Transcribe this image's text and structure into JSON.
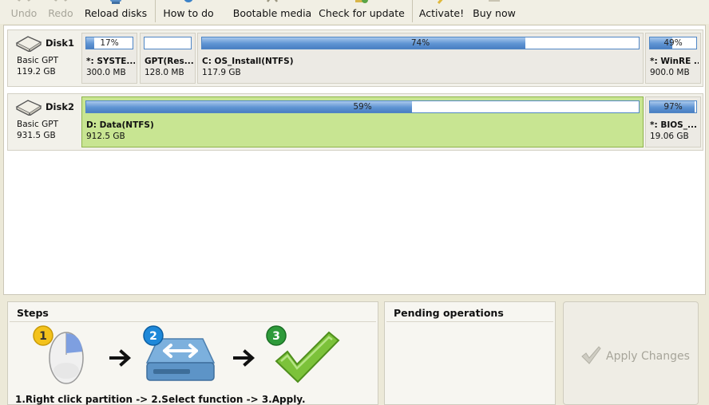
{
  "toolbar": {
    "undo": "Undo",
    "redo": "Redo",
    "reload": "Reload disks",
    "howto": "How to do",
    "bootable": "Bootable media",
    "update": "Check for update",
    "activate": "Activate!",
    "buy": "Buy now"
  },
  "disks": [
    {
      "name": "Disk1",
      "type": "Basic GPT",
      "size": "119.2 GB",
      "partitions": [
        {
          "label": "*: SYSTE...",
          "size": "300.0 MB",
          "used_pct": 17,
          "pct_text": "17%"
        },
        {
          "label": "GPT(Res...",
          "size": "128.0 MB",
          "used_pct": 0,
          "pct_text": ""
        },
        {
          "label": "C: OS_Install(NTFS)",
          "size": "117.9 GB",
          "used_pct": 74,
          "pct_text": "74%"
        },
        {
          "label": "*: WinRE ...",
          "size": "900.0 MB",
          "used_pct": 49,
          "pct_text": "49%"
        }
      ]
    },
    {
      "name": "Disk2",
      "type": "Basic GPT",
      "size": "931.5 GB",
      "partitions": [
        {
          "label": "D: Data(NTFS)",
          "size": "912.5 GB",
          "used_pct": 59,
          "pct_text": "59%",
          "selected": true
        },
        {
          "label": "*: BIOS_...",
          "size": "19.06 GB",
          "used_pct": 97,
          "pct_text": "97%"
        }
      ]
    }
  ],
  "steps": {
    "title": "Steps",
    "badges": [
      "1",
      "2",
      "3"
    ],
    "text": "1.Right click partition -> 2.Select function -> 3.Apply."
  },
  "pending": {
    "title": "Pending operations"
  },
  "apply": {
    "label": "Apply Changes"
  },
  "colors": {
    "bar_fill": "#5f94d3",
    "selected_bg": "#c8e592",
    "badge_yellow": "#f3c21b",
    "badge_blue": "#1e88d9",
    "badge_green": "#2e9a3a",
    "check_green": "#7cc23a"
  }
}
